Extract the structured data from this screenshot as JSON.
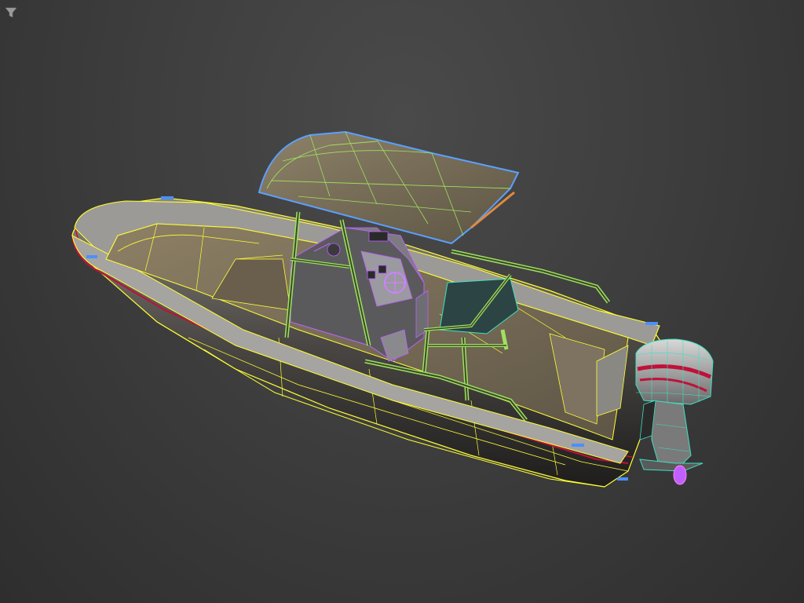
{
  "viewport": {
    "background": "#3e3e3e",
    "filter_icon": "filter-icon"
  },
  "model": {
    "name_hidden": true,
    "wire_colors": {
      "hull": "#ffff33",
      "stripe": "#c0103a",
      "bimini_top": "#5aa0ff",
      "rails": "#a0e060",
      "console": "#c060ff",
      "engine": "#40e0c0"
    }
  }
}
